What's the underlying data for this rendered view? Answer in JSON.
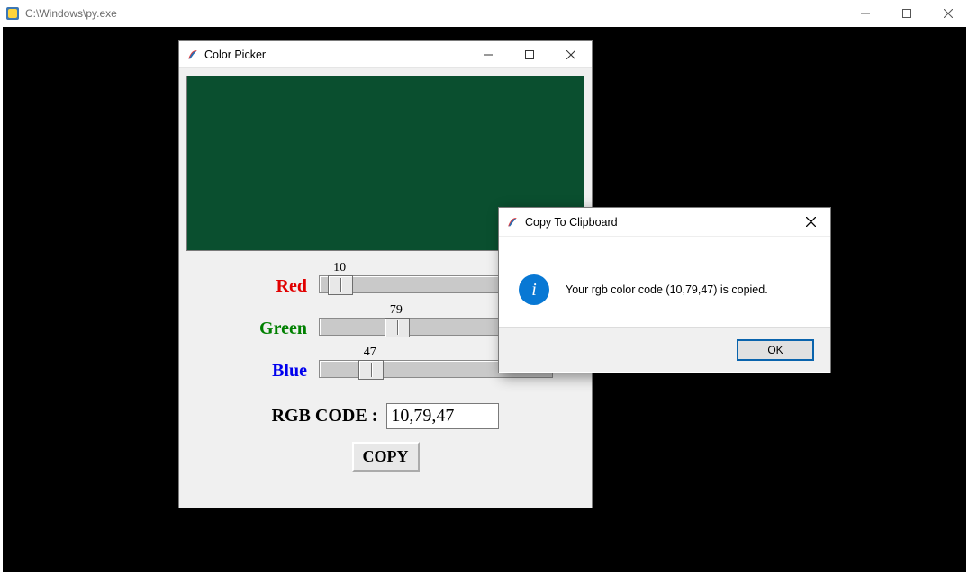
{
  "outer_window": {
    "title": "C:\\Windows\\py.exe"
  },
  "picker_window": {
    "title": "Color Picker",
    "swatch_color": "#0a4f2f",
    "sliders": {
      "red": {
        "label": "Red",
        "value": 10,
        "max": 255
      },
      "green": {
        "label": "Green",
        "value": 79,
        "max": 255
      },
      "blue": {
        "label": "Blue",
        "value": 47,
        "max": 255
      }
    },
    "rgbcode_label": "RGB CODE :",
    "rgbcode_value": "10,79,47",
    "copy_label": "COPY"
  },
  "messagebox": {
    "title": "Copy To Clipboard",
    "message": "Your rgb color code (10,79,47) is copied.",
    "ok_label": "OK"
  }
}
